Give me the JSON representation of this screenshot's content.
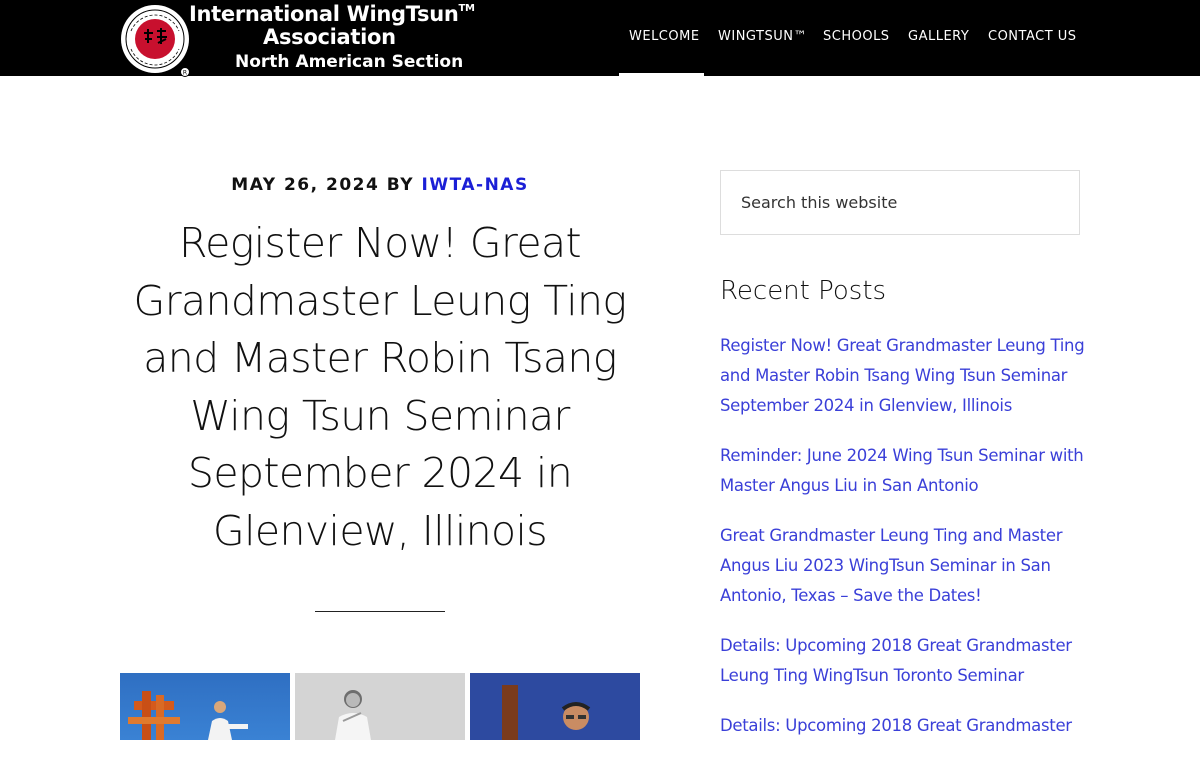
{
  "header": {
    "logo": {
      "line1": "International WingTsun",
      "trademark": "TM",
      "line2": "Association",
      "line3": "North American Section",
      "seal_text_top": "LEUNG TING",
      "seal_text_bottom": "WINGTSUN KUNGFU",
      "registered_mark": "®"
    },
    "nav": [
      {
        "label": "WELCOME",
        "active": true
      },
      {
        "label": "WINGTSUN™",
        "active": false
      },
      {
        "label": "SCHOOLS",
        "active": false
      },
      {
        "label": "GALLERY",
        "active": false
      },
      {
        "label": "CONTACT US",
        "active": false
      }
    ]
  },
  "post": {
    "date": "MAY 26, 2024",
    "by": "BY",
    "author": "IWTA-NAS",
    "title": "Register Now! Great Grandmaster Leung Ting and Master Robin Tsang Wing Tsun Seminar September 2024 in Glenview, Illinois"
  },
  "sidebar": {
    "search_placeholder": "Search this website",
    "recent_posts_title": "Recent Posts",
    "recent_posts": [
      "Register Now! Great Grandmaster Leung Ting and Master Robin Tsang Wing Tsun Seminar September 2024 in Glenview, Illinois",
      "Reminder: June 2024 Wing Tsun Seminar with Master Angus Liu in San Antonio",
      "Great Grandmaster Leung Ting and Master Angus Liu 2023 WingTsun Seminar in San Antonio, Texas – Save the Dates!",
      "Details: Upcoming 2018 Great Grandmaster Leung Ting WingTsun Toronto Seminar",
      "Details: Upcoming 2018 Great Grandmaster"
    ]
  },
  "colors": {
    "header_bg": "#000000",
    "link": "#3a3fd8",
    "author_link": "#1b1fd6",
    "seal_red": "#c8102e"
  }
}
